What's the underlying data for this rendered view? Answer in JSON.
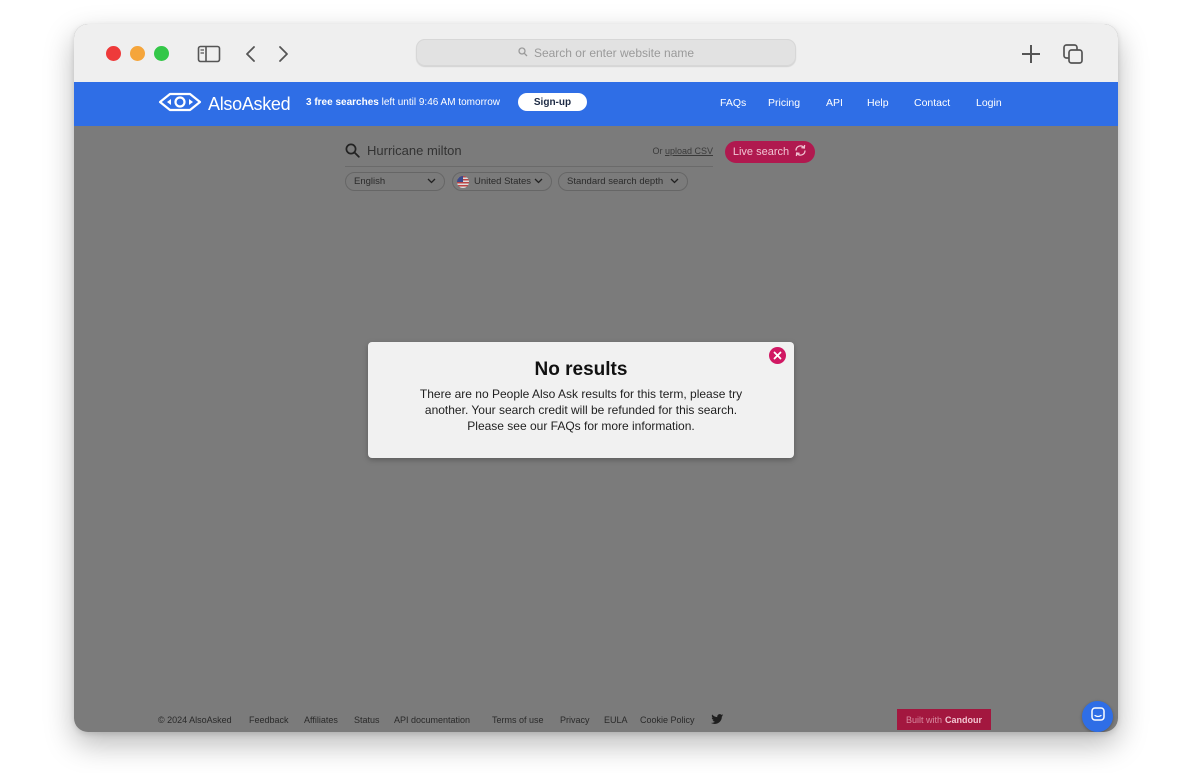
{
  "browser": {
    "address_placeholder": "Search or enter website name"
  },
  "header": {
    "logo_text": "AlsoAsked",
    "promo_bold": "3 free searches",
    "promo_rest": " left until 9:46 AM tomorrow",
    "signup_label": "Sign-up",
    "nav": [
      "FAQs",
      "Pricing",
      "API",
      "Help",
      "Contact",
      "Login"
    ]
  },
  "search": {
    "query": "Hurricane milton",
    "upload_prefix": "Or ",
    "upload_link": "upload CSV",
    "live_label": "Live search",
    "language": "English",
    "country": "United States",
    "depth": "Standard search depth"
  },
  "modal": {
    "title": "No results",
    "body": "There are no People Also Ask results for this term, please try another. Your search credit will be refunded for this search. Please see our FAQs for more information."
  },
  "footer": {
    "copyright": "© 2024 AlsoAsked",
    "links": [
      "Feedback",
      "Affiliates",
      "Status",
      "API documentation",
      "Terms of use",
      "Privacy",
      "EULA",
      "Cookie Policy"
    ],
    "built_with": "Built with",
    "built_brand": "Candour"
  },
  "colors": {
    "header_blue": "#2f6ee6",
    "live_search_pink": "#b0194f",
    "overlay_gray": "#7b7b7b",
    "close_pink": "#d11863"
  }
}
